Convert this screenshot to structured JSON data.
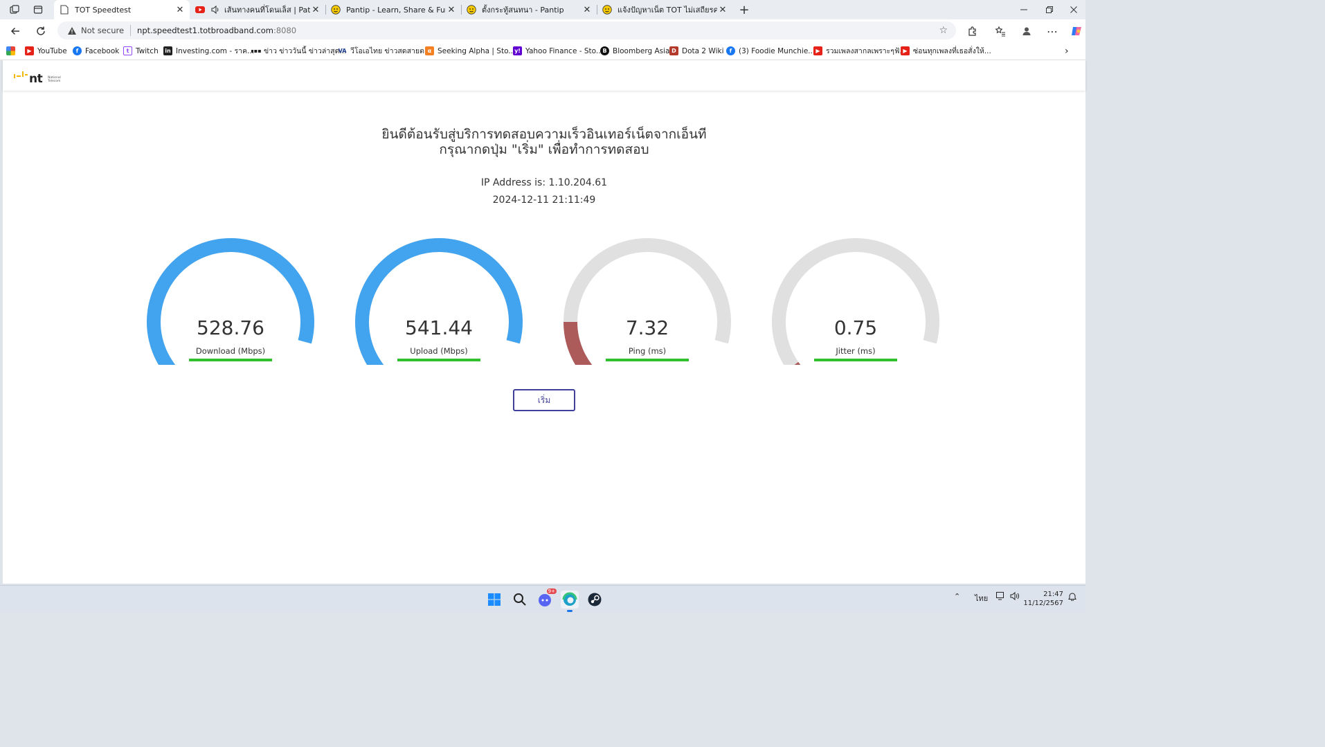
{
  "browser": {
    "tabs": [
      {
        "title": "TOT Speedtest",
        "icon": "page-icon",
        "active": true
      },
      {
        "title": "เส้นทางคนที่โดนเล็ส | Path of Exile",
        "icon": "youtube-icon",
        "audio": true
      },
      {
        "title": "Pantip - Learn, Share & Fun",
        "icon": "pantip-icon"
      },
      {
        "title": "ตั้งกระทู้สนทนา - Pantip",
        "icon": "pantip-icon"
      },
      {
        "title": "แจ้งปัญหาเน็ต TOT ไม่เสถียรครับ - Pantip",
        "icon": "pantip-icon"
      }
    ],
    "address": {
      "security_label": "Not secure",
      "host": "npt.speedtest1.totbroadband.com",
      "port": ":8080"
    },
    "bookmarks": [
      {
        "label": "YouTube",
        "icon": "youtube-icon"
      },
      {
        "label": "Facebook",
        "icon": "facebook-icon"
      },
      {
        "label": "Twitch",
        "icon": "twitch-icon"
      },
      {
        "label": "Investing.com - ราค...",
        "icon": "investing-icon"
      },
      {
        "label": "ข่าว ข่าววันนี้ ข่าวล่าสุด...",
        "icon": "news-icon"
      },
      {
        "label": "วีโอเอไทย ข่าวสดสายต...",
        "icon": "voa-icon"
      },
      {
        "label": "Seeking Alpha | Sto...",
        "icon": "seeking-alpha-icon"
      },
      {
        "label": "Yahoo Finance - Sto...",
        "icon": "yahoo-icon"
      },
      {
        "label": "Bloomberg Asia",
        "icon": "bloomberg-icon"
      },
      {
        "label": "Dota 2 Wiki",
        "icon": "dota-icon"
      },
      {
        "label": "(3) Foodie Munchie...",
        "icon": "facebook-icon"
      },
      {
        "label": "รวมเพลงสากลเพราะๆฟั...",
        "icon": "youtube-icon"
      },
      {
        "label": "ซ่อนทุกเพลงที่เธอสั่งให้...",
        "icon": "youtube-icon"
      }
    ]
  },
  "page": {
    "logo_text": "nt",
    "logo_subtext_1": "National",
    "logo_subtext_2": "Telecom",
    "welcome_line1": "ยินดีต้อนรับสู่บริการทดสอบความเร็วอินเทอร์เน็ตจากเอ็นที",
    "welcome_line2": "กรุณากดปุ่ม \"เริ่ม\" เพื่อทำการทดสอบ",
    "ip_text": "IP Address is: 1.10.204.61",
    "datetime": "2024-12-11 21:11:49",
    "gauges": [
      {
        "value": "528.76",
        "label": "Download (Mbps)",
        "fill": 1.0,
        "color": "#42a3ef"
      },
      {
        "value": "541.44",
        "label": "Upload (Mbps)",
        "fill": 1.0,
        "color": "#42a3ef"
      },
      {
        "value": "7.32",
        "label": "Ping (ms)",
        "fill": 0.22,
        "color": "#ad5a5a"
      },
      {
        "value": "0.75",
        "label": "Jitter (ms)",
        "fill": 0.08,
        "color": "#ad5a5a"
      }
    ],
    "start_button": "เริ่ม"
  },
  "taskbar": {
    "lang": "ไทย",
    "time": "21:47",
    "date": "11/12/2567",
    "badge": "9+"
  }
}
